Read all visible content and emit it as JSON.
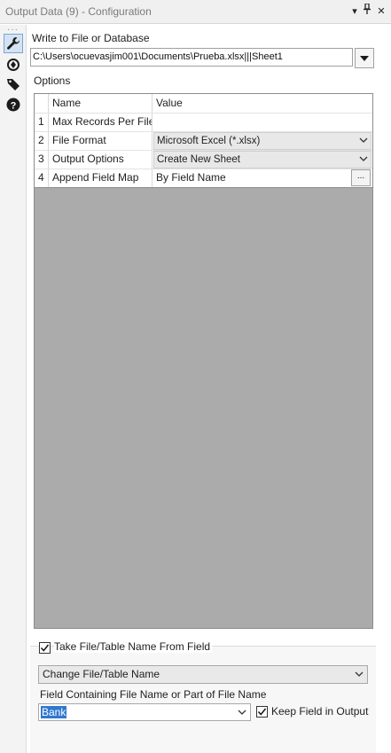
{
  "titlebar": {
    "title": "Output Data (9) - Configuration",
    "menu_glyph": "▾",
    "pin_glyph": "⊥",
    "close_glyph": "✕"
  },
  "toolbar": {
    "icons": [
      "wrench-icon",
      "target-icon",
      "tag-icon",
      "help-icon"
    ]
  },
  "write_section": {
    "label": "Write to File or Database",
    "path_value": "C:\\Users\\ocuevasjim001\\Documents\\Prueba.xlsx|||Sheet1"
  },
  "options": {
    "label": "Options",
    "headers": {
      "name": "Name",
      "value": "Value"
    },
    "rows": [
      {
        "num": "1",
        "name": "Max Records Per File",
        "value": ""
      },
      {
        "num": "2",
        "name": "File Format",
        "value": "Microsoft Excel (*.xlsx)"
      },
      {
        "num": "3",
        "name": "Output Options",
        "value": "Create New Sheet"
      },
      {
        "num": "4",
        "name": "Append Field Map",
        "value": "By Field Name",
        "button": "..."
      }
    ]
  },
  "name_from_field": {
    "checkbox_label": "Take File/Table Name From Field",
    "checked": true,
    "mode_value": "Change File/Table Name",
    "field_label": "Field Containing File Name or Part of File Name",
    "field_value": "Bank",
    "keep_label": "Keep Field in Output",
    "keep_checked": true
  },
  "colors": {
    "selection": "#3078d0",
    "grid_empty": "#ababab",
    "active_tool": "#d3e3f3"
  }
}
